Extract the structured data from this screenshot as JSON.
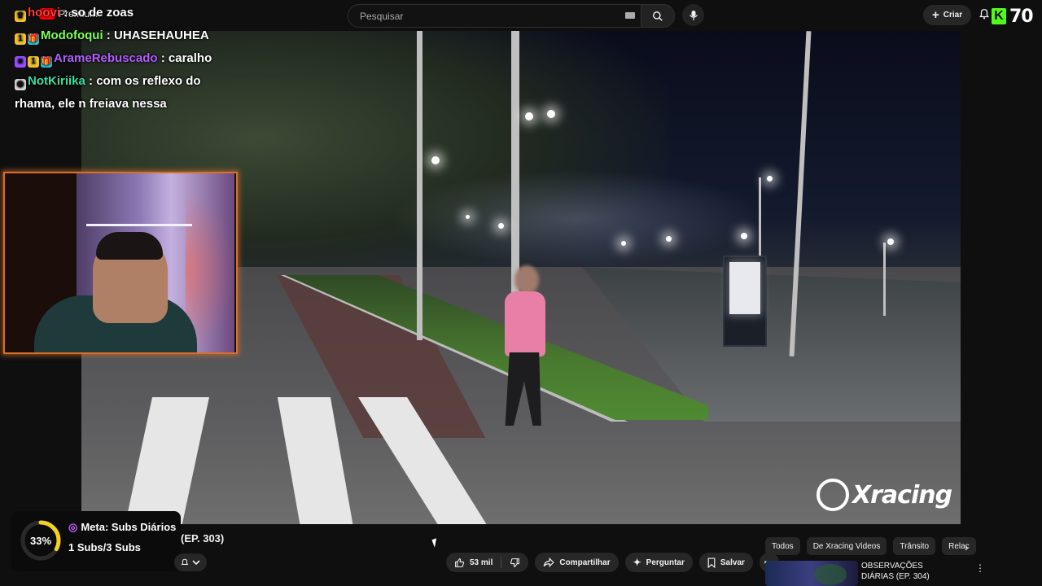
{
  "header": {
    "premium_label": "Premium",
    "search_placeholder": "Pesquisar",
    "create_label": "Criar",
    "level": "70"
  },
  "chat": [
    {
      "user": "hoovi",
      "user_color": "#ff3b3b",
      "badges": [
        "crown"
      ],
      "message": "so de zoas"
    },
    {
      "user": "Modofoqui",
      "user_color": "#7dff5a",
      "badges": [
        "1",
        "gift"
      ],
      "message": "UHASEHAUHEA"
    },
    {
      "user": "ArameRebuscado",
      "user_color": "#b35cff",
      "badges": [
        "cube",
        "1",
        "gift"
      ],
      "message": "caralho"
    },
    {
      "user": "NotKiriika",
      "user_color": "#35e0a0",
      "badges": [
        "glasses"
      ],
      "message": "com os reflexo do rhama, ele n freiava nessa"
    }
  ],
  "video": {
    "watermark": "Xracing"
  },
  "goal": {
    "percent_label": "33%",
    "percent": 33,
    "title": "Meta: Subs Diários",
    "progress": "1 Subs/3 Subs",
    "ring_color": "#f5d020"
  },
  "below_video": {
    "title_fragment": "(EP. 303)",
    "likes": "53 mil",
    "share_label": "Compartilhar",
    "ask_label": "Perguntar",
    "save_label": "Salvar"
  },
  "sidebar": {
    "chips": [
      "Todos",
      "De Xracing Videos",
      "Trânsito",
      "Relac"
    ],
    "recommendation": {
      "title": "OBSERVAÇÕES DIÁRIAS (EP. 304)"
    }
  },
  "colors": {
    "background": "#0f0f0f",
    "pill": "#272727",
    "kick_green": "#53fc18",
    "webcam_border": "#d9702a"
  }
}
